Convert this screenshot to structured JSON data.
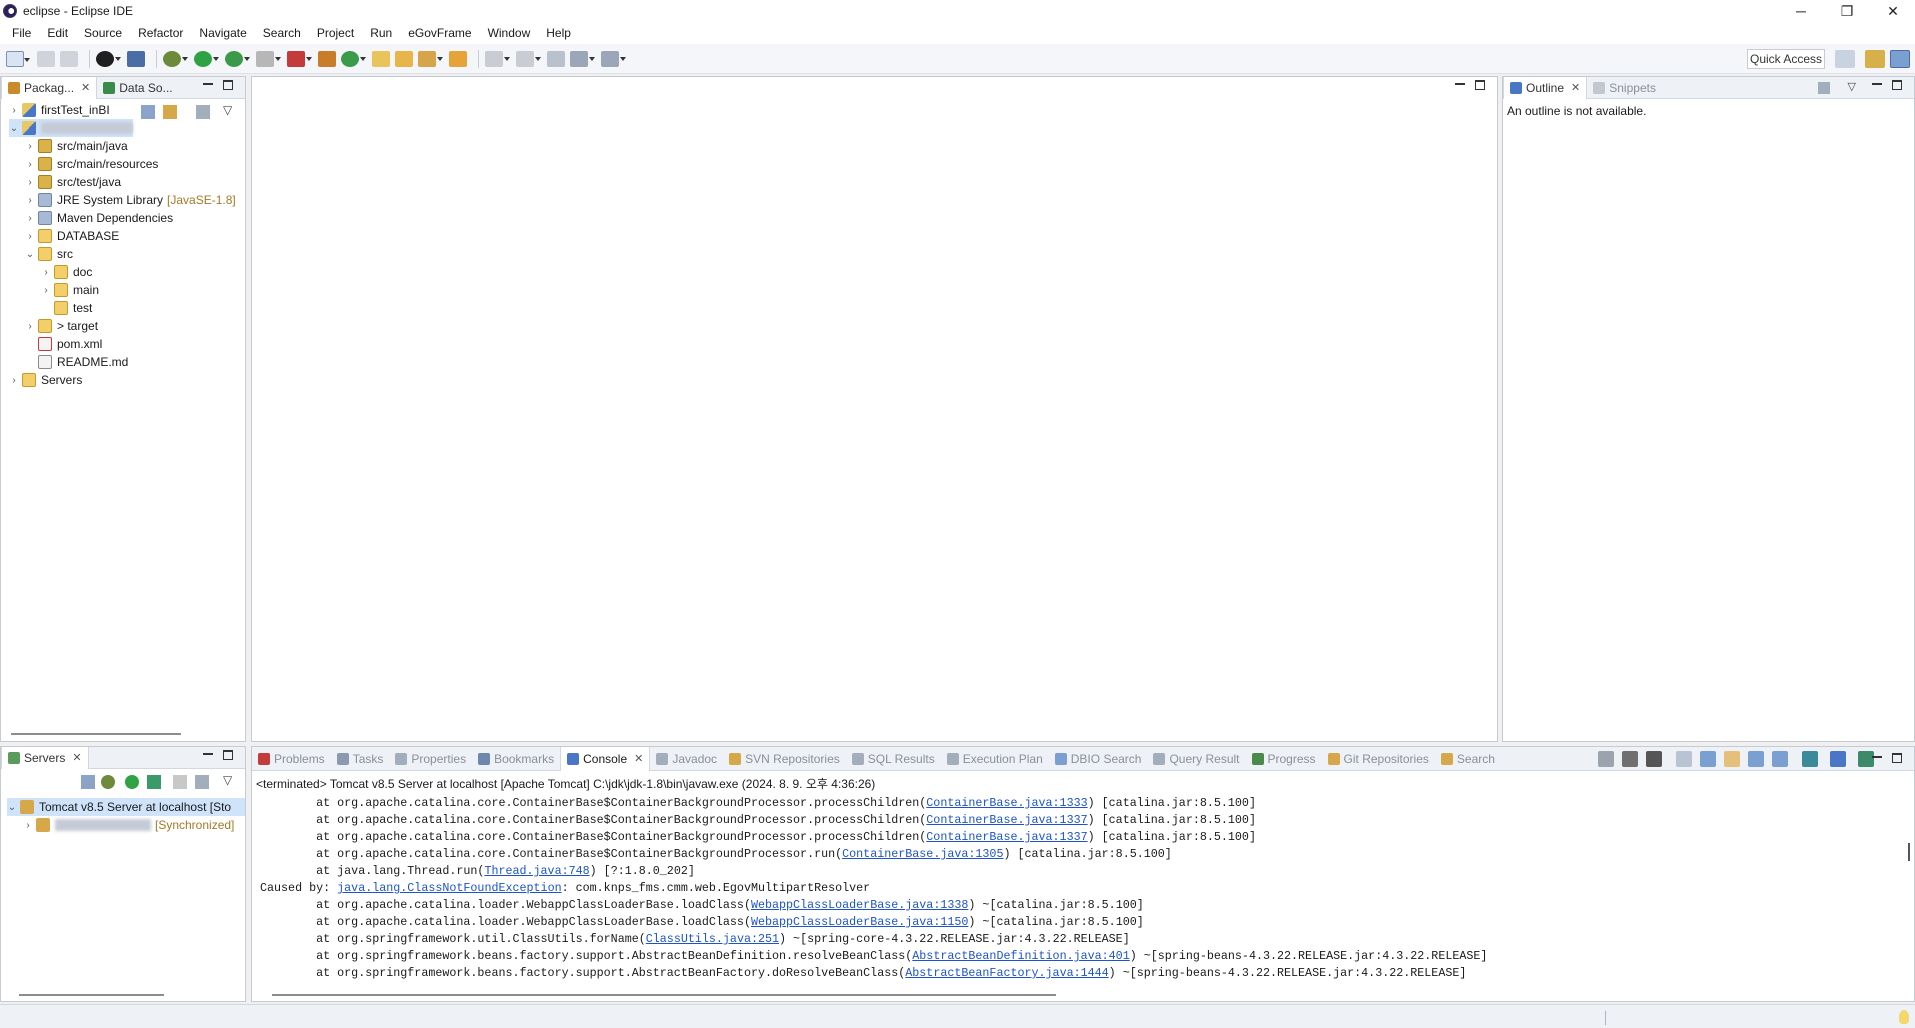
{
  "window": {
    "title": "eclipse - Eclipse IDE",
    "controls": [
      "─",
      "❐",
      "✕"
    ]
  },
  "menu": [
    "File",
    "Edit",
    "Source",
    "Refactor",
    "Navigate",
    "Search",
    "Project",
    "Run",
    "eGovFrame",
    "Window",
    "Help"
  ],
  "toolbar": {
    "quick_access": "Quick Access"
  },
  "explorer": {
    "tabs": [
      {
        "label": "Packag...",
        "icon": "package-explorer-icon"
      },
      {
        "label": "Data So...",
        "icon": "data-source-icon"
      }
    ],
    "tree": [
      {
        "label": "firstTest_inBI",
        "level": 0,
        "chev": "›",
        "icon": "proj"
      },
      {
        "label": "",
        "level": 0,
        "chev": "⌄",
        "icon": "proj",
        "redacted": true
      },
      {
        "label": "src/main/java",
        "level": 1,
        "chev": "›",
        "icon": "pkg"
      },
      {
        "label": "src/main/resources",
        "level": 1,
        "chev": "›",
        "icon": "pkg"
      },
      {
        "label": "src/test/java",
        "level": 1,
        "chev": "›",
        "icon": "pkg"
      },
      {
        "label": "JRE System Library",
        "decor": "[JavaSE-1.8]",
        "level": 1,
        "chev": "›",
        "icon": "lib"
      },
      {
        "label": "Maven Dependencies",
        "level": 1,
        "chev": "›",
        "icon": "lib"
      },
      {
        "label": "DATABASE",
        "level": 1,
        "chev": "›",
        "icon": "folder"
      },
      {
        "label": "src",
        "level": 1,
        "chev": "⌄",
        "icon": "folder"
      },
      {
        "label": "doc",
        "level": 2,
        "chev": "›",
        "icon": "folder"
      },
      {
        "label": "main",
        "level": 2,
        "chev": "›",
        "icon": "folder"
      },
      {
        "label": "test",
        "level": 2,
        "chev": "",
        "icon": "folder"
      },
      {
        "label": "> target",
        "level": 1,
        "chev": "›",
        "icon": "folder"
      },
      {
        "label": "pom.xml",
        "level": 1,
        "chev": "",
        "icon": "xml"
      },
      {
        "label": "README.md",
        "level": 1,
        "chev": "",
        "icon": "file"
      },
      {
        "label": "Servers",
        "level": 0,
        "chev": "›",
        "icon": "folder"
      }
    ]
  },
  "outline": {
    "tabs": [
      {
        "label": "Outline"
      },
      {
        "label": "Snippets"
      }
    ],
    "message": "An outline is not available."
  },
  "servers": {
    "tab": "Servers",
    "rows": [
      {
        "label": "Tomcat v8.5 Server at localhost  [Sto",
        "chev": "⌄"
      },
      {
        "label": "",
        "decor": "[Synchronized]",
        "chev": "›",
        "redacted": true
      }
    ]
  },
  "bottom": {
    "tabs": [
      "Problems",
      "Tasks",
      "Properties",
      "Bookmarks",
      "Console",
      "Javadoc",
      "SVN Repositories",
      "SQL Results",
      "Execution Plan",
      "DBIO Search",
      "Query Result",
      "Progress",
      "Git Repositories",
      "Search"
    ],
    "active_tab": "Console",
    "console_header": "<terminated> Tomcat v8.5 Server at localhost [Apache Tomcat] C:\\jdk\\jdk-1.8\\bin\\javaw.exe (2024. 8. 9. 오후 4:36:26)",
    "lines": [
      {
        "pre": "\tat org.apache.catalina.core.ContainerBase$ContainerBackgroundProcessor.processChildren(",
        "link": "ContainerBase.java:1333",
        "post": ") [catalina.jar:8.5.100]"
      },
      {
        "pre": "\tat org.apache.catalina.core.ContainerBase$ContainerBackgroundProcessor.processChildren(",
        "link": "ContainerBase.java:1337",
        "post": ") [catalina.jar:8.5.100]"
      },
      {
        "pre": "\tat org.apache.catalina.core.ContainerBase$ContainerBackgroundProcessor.processChildren(",
        "link": "ContainerBase.java:1337",
        "post": ") [catalina.jar:8.5.100]"
      },
      {
        "pre": "\tat org.apache.catalina.core.ContainerBase$ContainerBackgroundProcessor.run(",
        "link": "ContainerBase.java:1305",
        "post": ") [catalina.jar:8.5.100]"
      },
      {
        "pre": "\tat java.lang.Thread.run(",
        "link": "Thread.java:748",
        "post": ") [?:1.8.0_202]"
      },
      {
        "pre": "Caused by: ",
        "link": "java.lang.ClassNotFoundException",
        "post": ": com.knps_fms.cmm.web.EgovMultipartResolver"
      },
      {
        "pre": "\tat org.apache.catalina.loader.WebappClassLoaderBase.loadClass(",
        "link": "WebappClassLoaderBase.java:1338",
        "post": ") ~[catalina.jar:8.5.100]"
      },
      {
        "pre": "\tat org.apache.catalina.loader.WebappClassLoaderBase.loadClass(",
        "link": "WebappClassLoaderBase.java:1150",
        "post": ") ~[catalina.jar:8.5.100]"
      },
      {
        "pre": "\tat org.springframework.util.ClassUtils.forName(",
        "link": "ClassUtils.java:251",
        "post": ") ~[spring-core-4.3.22.RELEASE.jar:4.3.22.RELEASE]"
      },
      {
        "pre": "\tat org.springframework.beans.factory.support.AbstractBeanDefinition.resolveBeanClass(",
        "link": "AbstractBeanDefinition.java:401",
        "post": ") ~[spring-beans-4.3.22.RELEASE.jar:4.3.22.RELEASE]"
      },
      {
        "pre": "\tat org.springframework.beans.factory.support.AbstractBeanFactory.doResolveBeanClass(",
        "link": "AbstractBeanFactory.java:1444",
        "post": ") ~[spring-beans-4.3.22.RELEASE.jar:4.3.22.RELEASE]"
      }
    ]
  },
  "colors": {
    "accent": "#cfe3fa",
    "link": "#1d54c9",
    "panel_border": "#c6cbd3"
  }
}
